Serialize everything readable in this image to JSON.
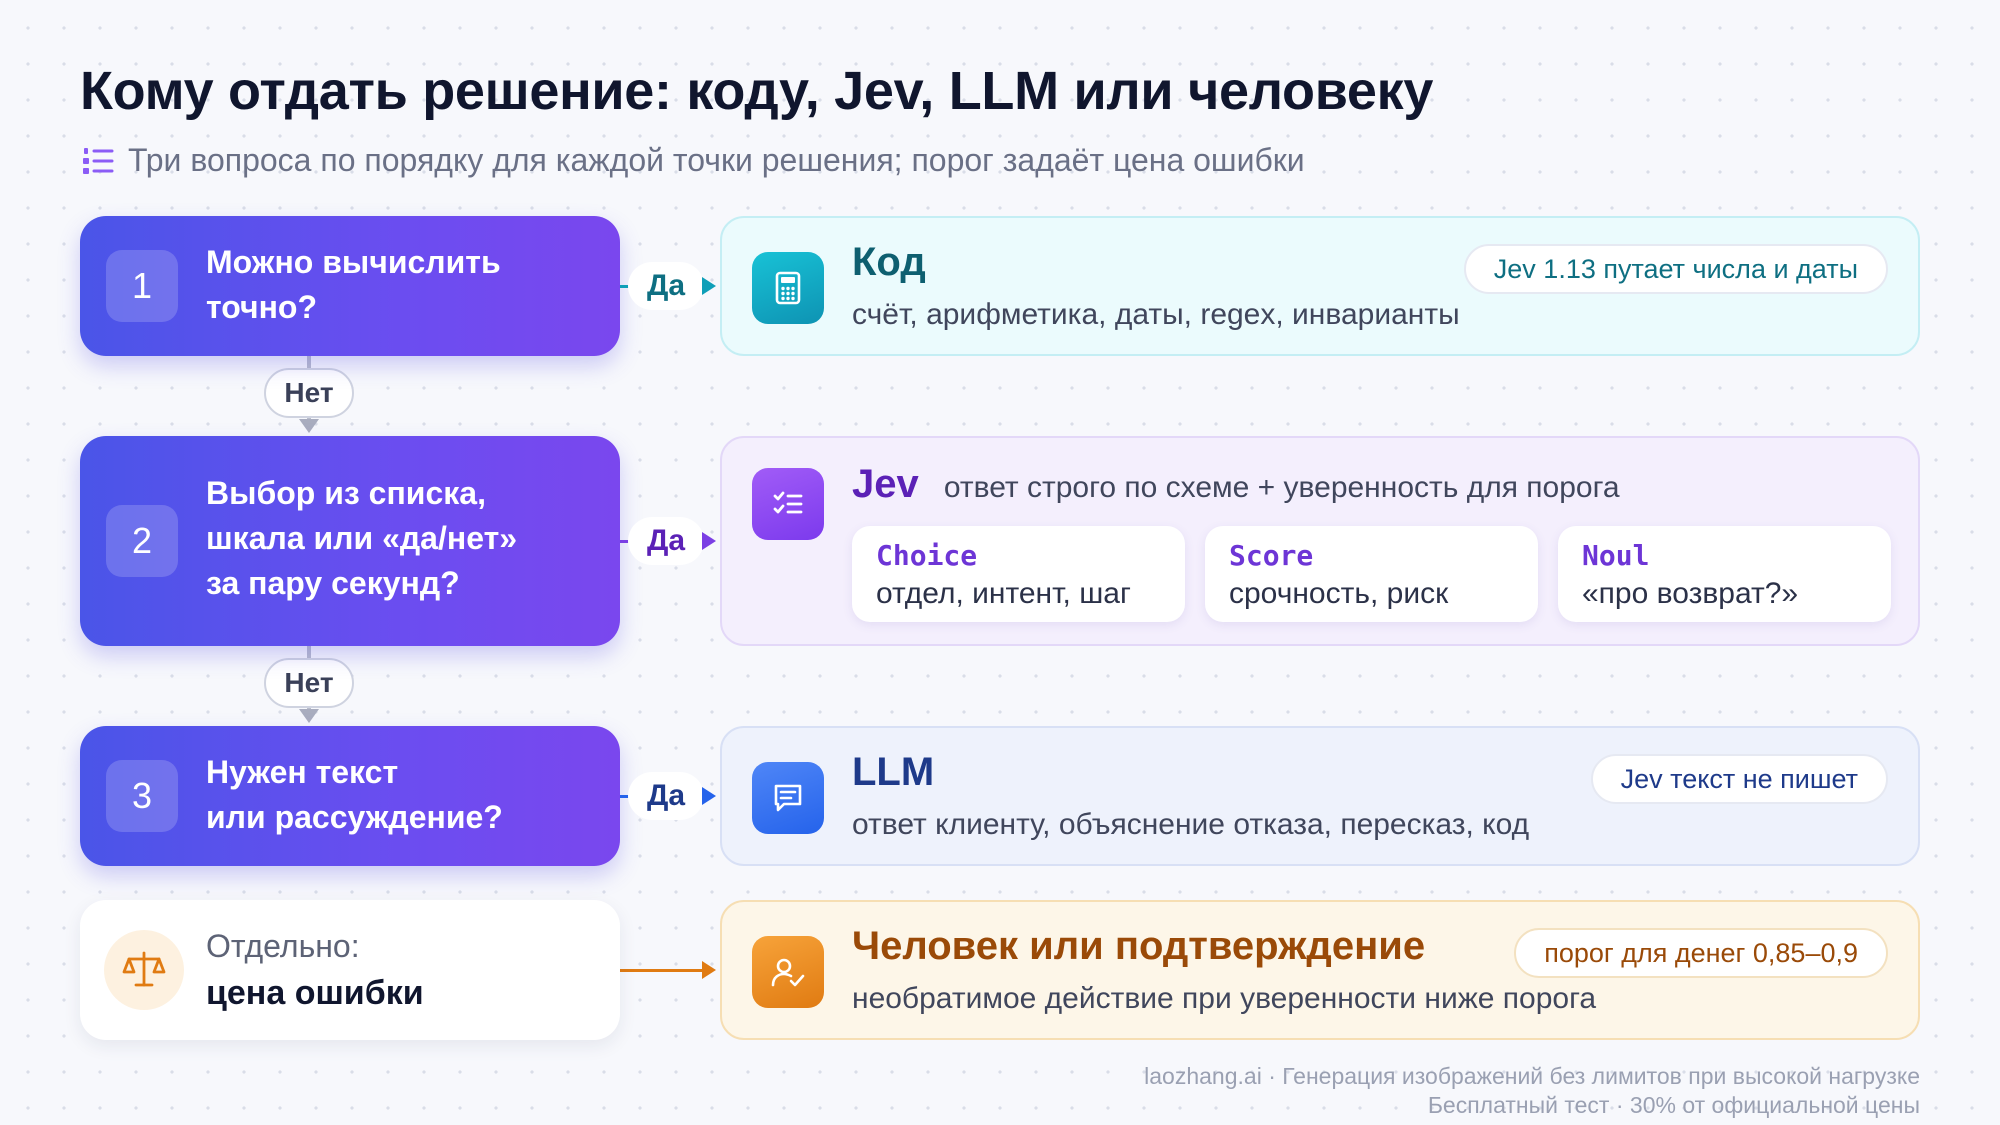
{
  "title": "Кому отдать решение: коду, Jev, LLM или человеку",
  "subtitle": "Три вопроса по порядку для каждой точки решения; порог задаёт цена ошибки",
  "questions": [
    {
      "num": "1",
      "text": "Можно вычислить\nточно?"
    },
    {
      "num": "2",
      "text": "Выбор из списка,\nшкала или «да/нет»\nза пару секунд?"
    },
    {
      "num": "3",
      "text": "Нужен текст\nили рассуждение?"
    }
  ],
  "yes_label": "Да",
  "no_label": "Нет",
  "separate": {
    "label": "Отдельно:",
    "value": "цена ошибки"
  },
  "cards": {
    "code": {
      "title": "Код",
      "desc": "счёт, арифметика, даты, regex, инварианты",
      "note": "Jev 1.13 путает числа и даты",
      "color": "#0f9fb8"
    },
    "jev": {
      "title": "Jev",
      "title_suffix": "ответ строго по схеме + уверенность для порога",
      "items": [
        {
          "name": "Choice",
          "desc": "отдел, интент, шаг"
        },
        {
          "name": "Score",
          "desc": "срочность, риск"
        },
        {
          "name": "Noul",
          "desc": "«про возврат?»"
        }
      ],
      "color": "#7b3fe4"
    },
    "llm": {
      "title": "LLM",
      "desc": "ответ клиенту, объяснение отказа, пересказ, код",
      "note": "Jev текст не пишет",
      "color": "#2563eb"
    },
    "human": {
      "title": "Человек или подтверждение",
      "desc": "необратимое действие при уверенности ниже порога",
      "note": "порог для денег 0,85–0,9",
      "color": "#e07b12"
    }
  },
  "footer": {
    "line1": "laozhang.ai · Генерация изображений без лимитов при высокой нагрузке",
    "line2": "Бесплатный тест · 30% от официальной цены"
  }
}
